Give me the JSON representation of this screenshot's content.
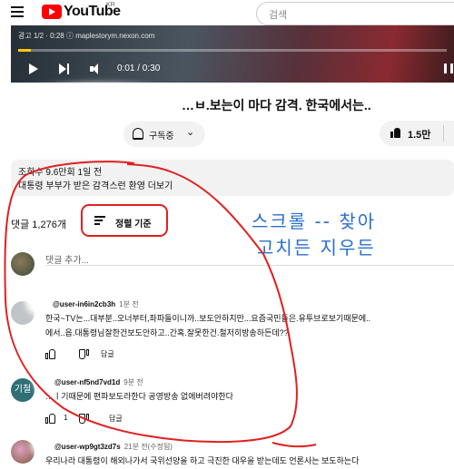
{
  "header": {
    "logo_text": "YouTube",
    "region": "KR",
    "search_placeholder": "검색"
  },
  "player": {
    "ad_info": "광고 1/2 · 0:28 ⓘ  maplestorym.nexon.com",
    "time": "0:01 / 0:30",
    "progress_fraction": 0.03
  },
  "video": {
    "title": "…ㅂ.보는이 마다 감격. 한국에서는..",
    "subscribe_label": "구독중",
    "like_count": "1.5만",
    "views_line": "조회수 9.6만회  1일 전",
    "description_line": "대통령 부부가 받은 감격스런 환영 더보기"
  },
  "comments": {
    "count_label": "댓글 1,276개",
    "sort_label": "정렬 기준",
    "add_placeholder": "댓글 추가...",
    "items": [
      {
        "user": "@user-in6in2cb3h",
        "time": "1분 전",
        "lines": [
          "한국~TV는...대부분..오너부터,좌파들이니까..보도안하지만...요즘국민들은.유투브로보기때문에..",
          "에서..읍.대통령님잘한건보도안하고..간혹.잘못한건.철저히방송하든데??."
        ],
        "likes": "",
        "reply": "답글",
        "avatar_color": "#bfc4c8"
      },
      {
        "user": "@user-nf5nd7vd1d",
        "time": "9분 전",
        "avatar_text": "기철",
        "lines": [
          "…ㅣ기때문에 편파보도라한다 공영방송 없에버려야한다"
        ],
        "likes": "1",
        "reply": "답글",
        "avatar_color": "#2f6f75"
      },
      {
        "user": "@user-wp9gt3zd7s",
        "time": "21분 전(수정됨)",
        "lines": [
          "우리나라 대통령이 해외나가서 국위선양을 하고 극진한 대우을 받는데도 언론사는 보도하는다"
        ],
        "likes": "",
        "reply": "답글",
        "avatar_color": "#c07a9a"
      }
    ]
  },
  "annotation": {
    "line1": "스크롤 -- 찾아",
    "line2": "고치든 지우든",
    "color": "#2a6fcd",
    "markup_color": "#e02020"
  }
}
